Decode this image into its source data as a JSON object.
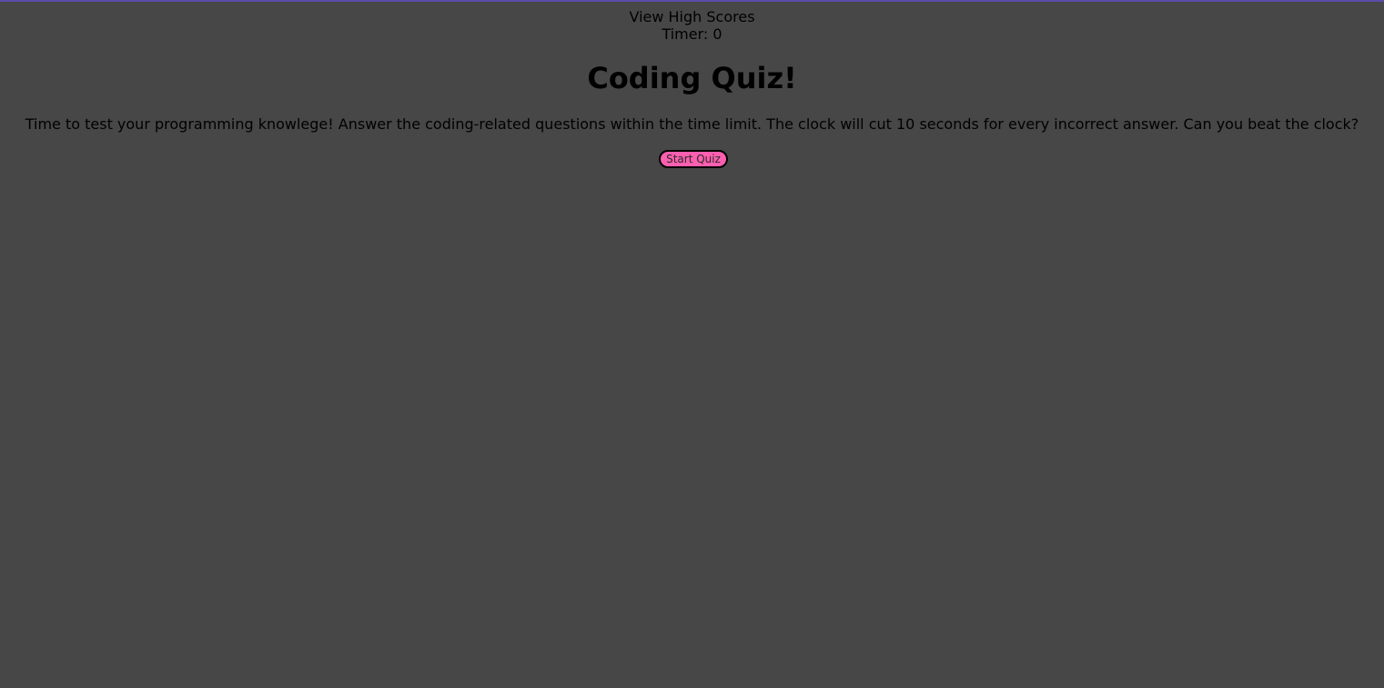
{
  "header": {
    "high_scores_label": "View High Scores",
    "timer_label": "Timer: 0"
  },
  "main": {
    "title": "Coding Quiz!",
    "intro": "Time to test your programming knowlege! Answer the coding-related questions within the time limit. The clock will cut 10 seconds for every incorrect answer. Can you beat the clock?",
    "start_label": "Start Quiz"
  },
  "colors": {
    "background": "#474747",
    "accent_top_border": "#5a4aa8",
    "start_button": "#ff5fb0"
  }
}
